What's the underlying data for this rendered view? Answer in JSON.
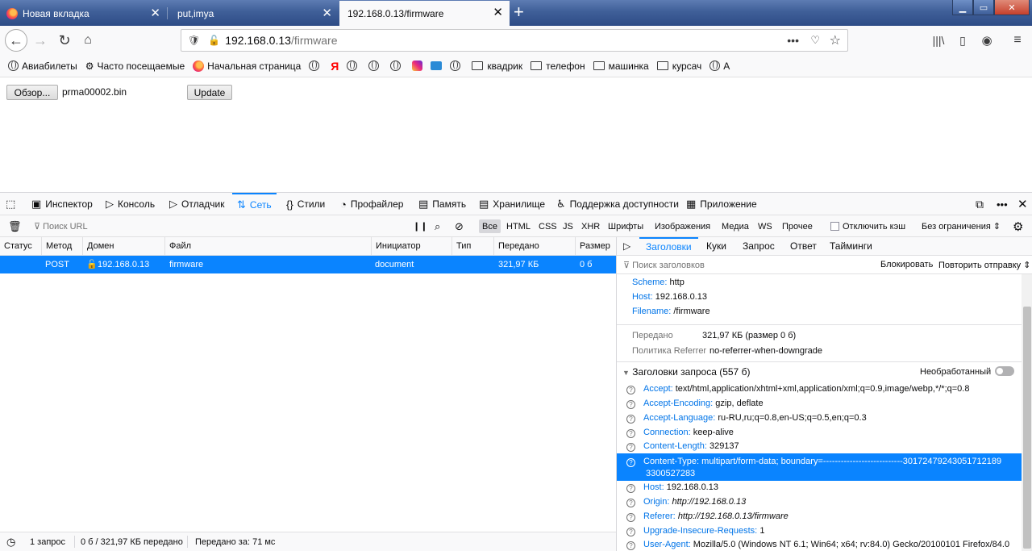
{
  "tabs": [
    {
      "title": "Новая вкладка"
    },
    {
      "title": "put,imya"
    },
    {
      "title": "192.168.0.13/firmware"
    }
  ],
  "urlbar": {
    "host": "192.168.0.13",
    "path": "/firmware"
  },
  "bookmarks": [
    "Авиабилеты",
    "Часто посещаемые",
    "Начальная страница",
    "Я",
    "квадрик",
    "телефон",
    "машинка",
    "курсач",
    "А"
  ],
  "page": {
    "browse_label": "Обзор...",
    "file_name": "prma00002.bin",
    "update_label": "Update"
  },
  "devtools": {
    "tabs": [
      "Инспектор",
      "Консоль",
      "Отладчик",
      "Сеть",
      "Стили",
      "Профайлер",
      "Память",
      "Хранилище",
      "Поддержка доступности",
      "Приложение"
    ],
    "filter_placeholder": "Поиск URL",
    "filters": [
      "Все",
      "HTML",
      "CSS",
      "JS",
      "XHR",
      "Шрифты",
      "Изображения",
      "Медиа",
      "WS",
      "Прочее"
    ],
    "disable_cache": "Отключить кэш",
    "throttling": "Без ограничения ⇕",
    "columns": [
      "Статус",
      "Метод",
      "Домен",
      "Файл",
      "Инициатор",
      "Тип",
      "Передано",
      "Размер"
    ],
    "request": {
      "method": "POST",
      "domain": "192.168.0.13",
      "file": "firmware",
      "initiator": "document",
      "transferred": "321,97 КБ",
      "size": "0 б"
    },
    "status": {
      "requests": "1 запрос",
      "transferred": "0 б / 321,97 КБ передано",
      "finish": "Передано за: 71 мс"
    },
    "side_tabs": [
      "Заголовки",
      "Куки",
      "Запрос",
      "Ответ",
      "Тайминги"
    ],
    "side_filter_placeholder": "Поиск заголовков",
    "block_label": "Блокировать",
    "resend_label": "Повторить отправку ⇕",
    "summary": [
      {
        "k": "Scheme:",
        "v": "http"
      },
      {
        "k": "Host:",
        "v": "192.168.0.13"
      },
      {
        "k": "Filename:",
        "v": "/firmware"
      }
    ],
    "transferred_label": "Передано",
    "transferred_value": "321,97 КБ (размер 0 б)",
    "referrer_label": "Политика Referrer",
    "referrer_value": "no-referrer-when-downgrade",
    "req_headers_title": "Заголовки запроса (557 б)",
    "raw_label": "Необработанный",
    "headers": [
      {
        "k": "Accept:",
        "v": "text/html,application/xhtml+xml,application/xml;q=0.9,image/webp,*/*;q=0.8"
      },
      {
        "k": "Accept-Encoding:",
        "v": "gzip, deflate"
      },
      {
        "k": "Accept-Language:",
        "v": "ru-RU,ru;q=0.8,en-US;q=0.5,en;q=0.3"
      },
      {
        "k": "Connection:",
        "v": "keep-alive"
      },
      {
        "k": "Content-Length:",
        "v": "329137"
      },
      {
        "k": "Content-Type:",
        "v": "multipart/form-data; boundary=---------------------------301724792430517121893300527283"
      },
      {
        "k": "Host:",
        "v": "192.168.0.13"
      },
      {
        "k": "Origin:",
        "v": "http://192.168.0.13"
      },
      {
        "k": "Referer:",
        "v": "http://192.168.0.13/firmware"
      },
      {
        "k": "Upgrade-Insecure-Requests:",
        "v": "1"
      },
      {
        "k": "User-Agent:",
        "v": "Mozilla/5.0 (Windows NT 6.1; Win64; x64; rv:84.0) Gecko/20100101 Firefox/84.0"
      }
    ],
    "ct_line1": "multipart/form-data; boundary=---------------------------30172479243051712189",
    "ct_line2": "3300527283"
  },
  "colors": {
    "accent": "#0a84ff",
    "titlebar": "#3f5f98",
    "close_btn": "#c7402c"
  }
}
